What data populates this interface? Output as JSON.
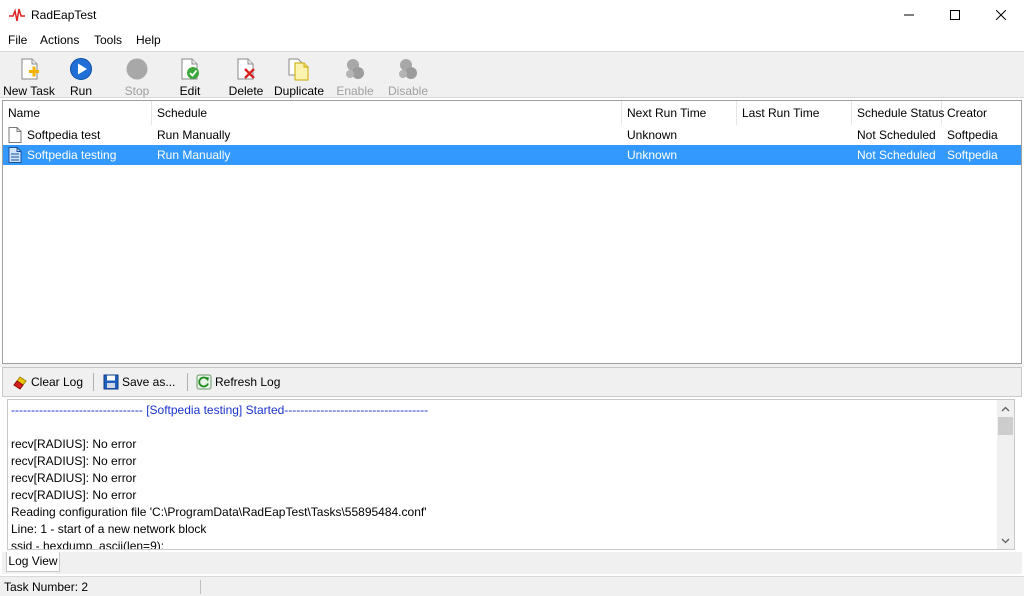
{
  "window": {
    "title": "RadEapTest",
    "icon": "pulse-icon"
  },
  "menu": [
    "File",
    "Actions",
    "Tools",
    "Help"
  ],
  "toolbar": {
    "new_task": "New Task",
    "run": "Run",
    "stop": "Stop",
    "edit": "Edit",
    "delete": "Delete",
    "duplicate": "Duplicate",
    "enable": "Enable",
    "disable": "Disable"
  },
  "task_list": {
    "columns": [
      "Name",
      "Schedule",
      "Next Run Time",
      "Last Run Time",
      "Schedule Status",
      "Creator"
    ],
    "rows": [
      {
        "name": "Softpedia test",
        "schedule": "Run Manually",
        "next_run": "Unknown",
        "last_run": "",
        "status": "Not Scheduled",
        "creator": "Softpedia",
        "selected": false
      },
      {
        "name": "Softpedia testing",
        "schedule": "Run Manually",
        "next_run": "Unknown",
        "last_run": "",
        "status": "Not Scheduled",
        "creator": "Softpedia",
        "selected": true
      }
    ]
  },
  "log_toolbar": {
    "clear": "Clear Log",
    "save": "Save as...",
    "refresh": "Refresh Log"
  },
  "log_lines": [
    {
      "text": "--------------------------------- [Softpedia testing] Started------------------------------------",
      "banner": true
    },
    {
      "text": "",
      "banner": false
    },
    {
      "text": "recv[RADIUS]: No error",
      "banner": false
    },
    {
      "text": "recv[RADIUS]: No error",
      "banner": false
    },
    {
      "text": "recv[RADIUS]: No error",
      "banner": false
    },
    {
      "text": "recv[RADIUS]: No error",
      "banner": false
    },
    {
      "text": "Reading configuration file 'C:\\ProgramData\\RadEapTest\\Tasks\\55895484.conf'",
      "banner": false
    },
    {
      "text": "Line: 1 - start of a new network block",
      "banner": false
    },
    {
      "text": "ssid - hexdump_ascii(len=9):",
      "banner": false
    }
  ],
  "log_tab": "Log View",
  "status": "Task Number: 2",
  "colors": {
    "selection": "#3399ff",
    "log_banner": "#1a33cc",
    "toolbar_bg": "#f0f0f0"
  }
}
